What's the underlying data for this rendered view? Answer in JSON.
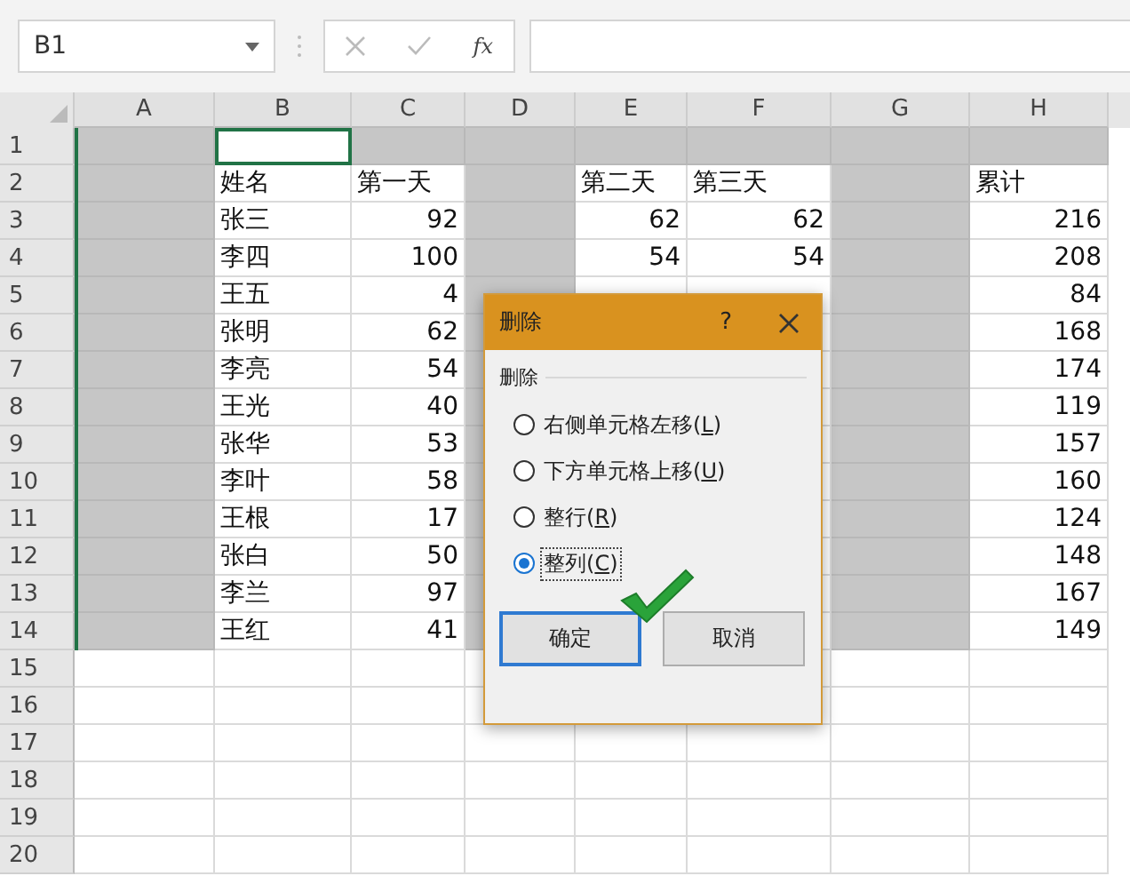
{
  "formula_bar": {
    "name_box": "B1",
    "fx_label": "fx"
  },
  "columns": [
    {
      "letter": "A"
    },
    {
      "letter": "B"
    },
    {
      "letter": "C"
    },
    {
      "letter": "D"
    },
    {
      "letter": "E"
    },
    {
      "letter": "F"
    },
    {
      "letter": "G"
    },
    {
      "letter": "H"
    }
  ],
  "rows": [
    {
      "number": "1",
      "cells": [
        {
          "shaded": true
        },
        {
          "shaded": false,
          "active": true
        },
        {
          "shaded": true
        },
        {
          "shaded": true
        },
        {
          "shaded": true
        },
        {
          "shaded": true
        },
        {
          "shaded": true
        },
        {
          "shaded": true
        }
      ]
    },
    {
      "number": "2",
      "cells": [
        {
          "shaded": true
        },
        {
          "shaded": false,
          "text": "姓名",
          "kind": "text"
        },
        {
          "shaded": false,
          "text": "第一天",
          "kind": "text"
        },
        {
          "shaded": true
        },
        {
          "shaded": false,
          "text": "第二天",
          "kind": "text"
        },
        {
          "shaded": false,
          "text": "第三天",
          "kind": "text"
        },
        {
          "shaded": true
        },
        {
          "shaded": false,
          "text": "累计",
          "kind": "text"
        }
      ]
    },
    {
      "number": "3",
      "cells": [
        {
          "shaded": true
        },
        {
          "shaded": false,
          "text": "张三",
          "kind": "text"
        },
        {
          "shaded": false,
          "text": "92",
          "kind": "number"
        },
        {
          "shaded": true
        },
        {
          "shaded": false,
          "text": "62",
          "kind": "number"
        },
        {
          "shaded": false,
          "text": "62",
          "kind": "number"
        },
        {
          "shaded": true
        },
        {
          "shaded": false,
          "text": "216",
          "kind": "number"
        }
      ]
    },
    {
      "number": "4",
      "cells": [
        {
          "shaded": true
        },
        {
          "shaded": false,
          "text": "李四",
          "kind": "text"
        },
        {
          "shaded": false,
          "text": "100",
          "kind": "number"
        },
        {
          "shaded": true
        },
        {
          "shaded": false,
          "text": "54",
          "kind": "number"
        },
        {
          "shaded": false,
          "text": "54",
          "kind": "number"
        },
        {
          "shaded": true
        },
        {
          "shaded": false,
          "text": "208",
          "kind": "number"
        }
      ]
    },
    {
      "number": "5",
      "cells": [
        {
          "shaded": true
        },
        {
          "shaded": false,
          "text": "王五",
          "kind": "text"
        },
        {
          "shaded": false,
          "text": "4",
          "kind": "number"
        },
        {
          "shaded": true
        },
        {
          "shaded": false
        },
        {
          "shaded": false
        },
        {
          "shaded": true
        },
        {
          "shaded": false,
          "text": "84",
          "kind": "number"
        }
      ]
    },
    {
      "number": "6",
      "cells": [
        {
          "shaded": true
        },
        {
          "shaded": false,
          "text": "张明",
          "kind": "text"
        },
        {
          "shaded": false,
          "text": "62",
          "kind": "number"
        },
        {
          "shaded": true
        },
        {},
        {
          "shaded": false
        },
        {
          "shaded": true
        },
        {
          "shaded": false,
          "text": "168",
          "kind": "number"
        }
      ]
    },
    {
      "number": "7",
      "cells": [
        {
          "shaded": true
        },
        {
          "shaded": false,
          "text": "李亮",
          "kind": "text"
        },
        {
          "shaded": false,
          "text": "54",
          "kind": "number"
        },
        {
          "shaded": true
        },
        {},
        {
          "shaded": false
        },
        {
          "shaded": true
        },
        {
          "shaded": false,
          "text": "174",
          "kind": "number"
        }
      ]
    },
    {
      "number": "8",
      "cells": [
        {
          "shaded": true
        },
        {
          "shaded": false,
          "text": "王光",
          "kind": "text"
        },
        {
          "shaded": false,
          "text": "40",
          "kind": "number"
        },
        {
          "shaded": true
        },
        {},
        {
          "shaded": false
        },
        {
          "shaded": true
        },
        {
          "shaded": false,
          "text": "119",
          "kind": "number"
        }
      ]
    },
    {
      "number": "9",
      "cells": [
        {
          "shaded": true
        },
        {
          "shaded": false,
          "text": "张华",
          "kind": "text"
        },
        {
          "shaded": false,
          "text": "53",
          "kind": "number"
        },
        {
          "shaded": true
        },
        {},
        {
          "shaded": false
        },
        {
          "shaded": true
        },
        {
          "shaded": false,
          "text": "157",
          "kind": "number"
        }
      ]
    },
    {
      "number": "10",
      "cells": [
        {
          "shaded": true
        },
        {
          "shaded": false,
          "text": "李叶",
          "kind": "text"
        },
        {
          "shaded": false,
          "text": "58",
          "kind": "number"
        },
        {
          "shaded": true
        },
        {},
        {
          "shaded": false
        },
        {
          "shaded": true
        },
        {
          "shaded": false,
          "text": "160",
          "kind": "number"
        }
      ]
    },
    {
      "number": "11",
      "cells": [
        {
          "shaded": true
        },
        {
          "shaded": false,
          "text": "王根",
          "kind": "text"
        },
        {
          "shaded": false,
          "text": "17",
          "kind": "number"
        },
        {
          "shaded": true
        },
        {},
        {
          "shaded": false
        },
        {
          "shaded": true
        },
        {
          "shaded": false,
          "text": "124",
          "kind": "number"
        }
      ]
    },
    {
      "number": "12",
      "cells": [
        {
          "shaded": true
        },
        {
          "shaded": false,
          "text": "张白",
          "kind": "text"
        },
        {
          "shaded": false,
          "text": "50",
          "kind": "number"
        },
        {
          "shaded": true
        },
        {},
        {
          "shaded": false
        },
        {
          "shaded": true
        },
        {
          "shaded": false,
          "text": "148",
          "kind": "number"
        }
      ]
    },
    {
      "number": "13",
      "cells": [
        {
          "shaded": true
        },
        {
          "shaded": false,
          "text": "李兰",
          "kind": "text"
        },
        {
          "shaded": false,
          "text": "97",
          "kind": "number"
        },
        {
          "shaded": true
        },
        {},
        {
          "shaded": false
        },
        {
          "shaded": true
        },
        {
          "shaded": false,
          "text": "167",
          "kind": "number"
        }
      ]
    },
    {
      "number": "14",
      "cells": [
        {
          "shaded": true
        },
        {
          "shaded": false,
          "text": "王红",
          "kind": "text"
        },
        {
          "shaded": false,
          "text": "41",
          "kind": "number"
        },
        {
          "shaded": true
        },
        {},
        {
          "shaded": false
        },
        {
          "shaded": true
        },
        {
          "shaded": false,
          "text": "149",
          "kind": "number"
        }
      ]
    },
    {
      "number": "15"
    },
    {
      "number": "16"
    },
    {
      "number": "17"
    },
    {
      "number": "18"
    },
    {
      "number": "19"
    },
    {
      "number": "20"
    }
  ],
  "dialog": {
    "title": "删除",
    "help": "?",
    "group_label": "删除",
    "options": [
      {
        "before": "右侧单元格左移(",
        "key": "L",
        "after": ")",
        "selected": false
      },
      {
        "before": "下方单元格上移(",
        "key": "U",
        "after": ")",
        "selected": false
      },
      {
        "before": "整行(",
        "key": "R",
        "after": ")",
        "selected": false
      },
      {
        "before": "整列(",
        "key": "C",
        "after": ")",
        "selected": true
      }
    ],
    "buttons": [
      {
        "label": "确定",
        "default": true
      },
      {
        "label": "取消",
        "default": false
      }
    ]
  }
}
